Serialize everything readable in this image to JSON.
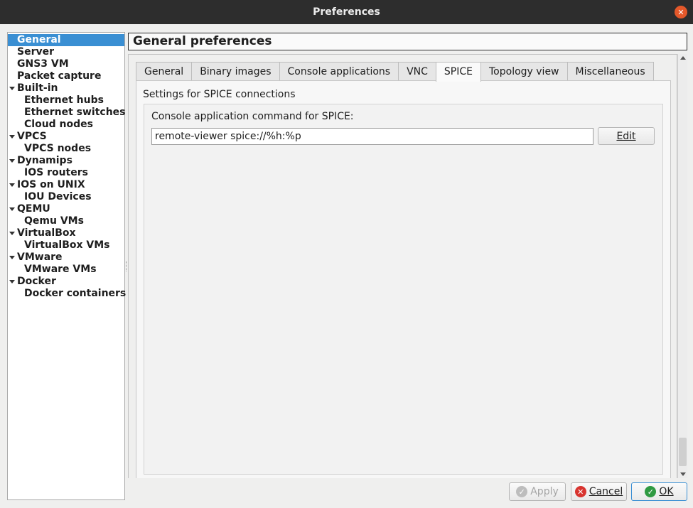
{
  "window": {
    "title": "Preferences",
    "close_glyph": "✕"
  },
  "sidebar": {
    "items": [
      {
        "label": "General",
        "selected": true,
        "expandable": false,
        "level": 0
      },
      {
        "label": "Server",
        "selected": false,
        "expandable": false,
        "level": 0
      },
      {
        "label": "GNS3 VM",
        "selected": false,
        "expandable": false,
        "level": 0
      },
      {
        "label": "Packet capture",
        "selected": false,
        "expandable": false,
        "level": 0
      },
      {
        "label": "Built-in",
        "selected": false,
        "expandable": true,
        "level": 0
      },
      {
        "label": "Ethernet hubs",
        "selected": false,
        "expandable": false,
        "level": 1
      },
      {
        "label": "Ethernet switches",
        "selected": false,
        "expandable": false,
        "level": 1
      },
      {
        "label": "Cloud nodes",
        "selected": false,
        "expandable": false,
        "level": 1
      },
      {
        "label": "VPCS",
        "selected": false,
        "expandable": true,
        "level": 0
      },
      {
        "label": "VPCS nodes",
        "selected": false,
        "expandable": false,
        "level": 1
      },
      {
        "label": "Dynamips",
        "selected": false,
        "expandable": true,
        "level": 0
      },
      {
        "label": "IOS routers",
        "selected": false,
        "expandable": false,
        "level": 1
      },
      {
        "label": "IOS on UNIX",
        "selected": false,
        "expandable": true,
        "level": 0
      },
      {
        "label": "IOU Devices",
        "selected": false,
        "expandable": false,
        "level": 1
      },
      {
        "label": "QEMU",
        "selected": false,
        "expandable": true,
        "level": 0
      },
      {
        "label": "Qemu VMs",
        "selected": false,
        "expandable": false,
        "level": 1
      },
      {
        "label": "VirtualBox",
        "selected": false,
        "expandable": true,
        "level": 0
      },
      {
        "label": "VirtualBox VMs",
        "selected": false,
        "expandable": false,
        "level": 1
      },
      {
        "label": "VMware",
        "selected": false,
        "expandable": true,
        "level": 0
      },
      {
        "label": "VMware VMs",
        "selected": false,
        "expandable": false,
        "level": 1
      },
      {
        "label": "Docker",
        "selected": false,
        "expandable": true,
        "level": 0
      },
      {
        "label": "Docker containers",
        "selected": false,
        "expandable": false,
        "level": 1
      }
    ]
  },
  "main": {
    "header": "General preferences",
    "tabs": [
      {
        "label": "General",
        "active": false
      },
      {
        "label": "Binary images",
        "active": false
      },
      {
        "label": "Console applications",
        "active": false
      },
      {
        "label": "VNC",
        "active": false
      },
      {
        "label": "SPICE",
        "active": true
      },
      {
        "label": "Topology view",
        "active": false
      },
      {
        "label": "Miscellaneous",
        "active": false
      }
    ],
    "spice": {
      "section_title": "Settings for SPICE connections",
      "field_label": "Console application command for SPICE:",
      "command_value": "remote-viewer spice://%h:%p",
      "edit_button": "Edit"
    }
  },
  "footer": {
    "apply_label": "Apply",
    "cancel_label": "Cancel",
    "ok_label": "OK"
  },
  "colors": {
    "selection": "#3a8fd3",
    "ok_icon": "#2f9a42",
    "cancel_icon": "#d8342f",
    "close_button": "#e4582a"
  }
}
